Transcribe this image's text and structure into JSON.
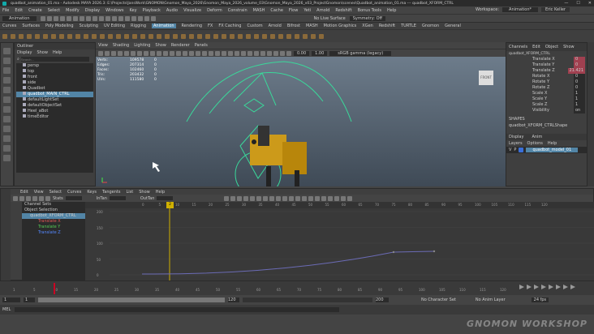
{
  "titlebar": {
    "title": "quadbot_animation_01.ma - Autodesk MAYA 2026.3: E:\\Projects\\JansWork\\GNOMON\\Gnomon_Maya_2026\\Gnomon_Maya_2026_volume_03\\Gnomon_Maya_2026_v03_ProjectGnomon\\scenes\\Quadbot_animation_01.ma --- quadbot_XFORM_CTRL"
  },
  "menubar": {
    "items": [
      "File",
      "Edit",
      "Create",
      "Select",
      "Modify",
      "Display",
      "Windows",
      "Key",
      "Playback",
      "Audio",
      "Visualize",
      "Deform",
      "Constrain",
      "MASH",
      "Cache",
      "Flow",
      "Yeti",
      "Arnold",
      "Redshift",
      "Bonus Tools",
      "Help"
    ],
    "workspace_label": "Workspace:",
    "workspace_value": "Animation*",
    "user": "Eric Keller"
  },
  "statusline": {
    "mode": "Animation",
    "no_live_surface": "No Live Surface",
    "symmetry": "Symmetry: Off"
  },
  "shelf_tabs": [
    "Curves",
    "Surfaces",
    "Poly Modeling",
    "Sculpting",
    "UV Editing",
    "Rigging",
    "Animation",
    "Rendering",
    "FX",
    "FX Caching",
    "Custom",
    "Arnold",
    "Bifrost",
    "MASH",
    "Motion Graphics",
    "XGen",
    "Redshift",
    "TURTLE",
    "Gnomon",
    "General"
  ],
  "outliner": {
    "title": "Outliner",
    "menus": [
      "Display",
      "Show",
      "Help"
    ],
    "search_placeholder": "Search...",
    "items": [
      "persp",
      "top",
      "front",
      "side",
      "Quadbot",
      "quadbot_MAIN_CTRL",
      "defaultLightSet",
      "defaultObjectSet",
      "Heel_aBot",
      "timeEditor"
    ]
  },
  "viewport": {
    "menus": [
      "View",
      "Shading",
      "Lighting",
      "Show",
      "Renderer",
      "Panels"
    ],
    "hud_labels": [
      "Verts:",
      "Edges:",
      "Faces:",
      "Tris:",
      "UVs:"
    ],
    "hud_values": [
      "109578",
      "207314",
      "102460",
      "203432",
      "111580"
    ],
    "hud_zero": [
      "0",
      "0",
      "0",
      "0",
      "0"
    ],
    "camera_label": "FRONT",
    "renderer": "sRGB gamma (legacy)",
    "field_a": "0.00",
    "field_b": "1.00"
  },
  "channelbox": {
    "menus": [
      "Channels",
      "Edit",
      "Object",
      "Show"
    ],
    "object": "quadbot_XFORM_CTRL",
    "channels": [
      {
        "name": "Translate X",
        "value": "0"
      },
      {
        "name": "Translate Y",
        "value": "0"
      },
      {
        "name": "Translate Z",
        "value": "21.421"
      },
      {
        "name": "Rotate X",
        "value": "0"
      },
      {
        "name": "Rotate Y",
        "value": "0"
      },
      {
        "name": "Rotate Z",
        "value": "0"
      },
      {
        "name": "Scale X",
        "value": "1"
      },
      {
        "name": "Scale Y",
        "value": "1"
      },
      {
        "name": "Scale Z",
        "value": "1"
      },
      {
        "name": "Visibility",
        "value": "on"
      }
    ],
    "shapes_label": "SHAPES",
    "shape_name": "quadbot_XFORM_CTRLShape",
    "layer_tabs": [
      "Display",
      "Anim"
    ],
    "layer_menus": [
      "Layers",
      "Options",
      "Help"
    ],
    "layer_name": "quadbot_model_01"
  },
  "grapheditor": {
    "menus": [
      "Edit",
      "View",
      "Select",
      "Curves",
      "Keys",
      "Tangents",
      "List",
      "Show",
      "Help"
    ],
    "stats_label": "Stats",
    "intan_label": "InTan",
    "outtan_label": "OutTan",
    "outline_items": [
      "Channel Sets",
      "Object Selection",
      "quadbot_XFORM_CTRL",
      "Translate X",
      "Translate Y",
      "Translate Z"
    ],
    "y_ticks": [
      "200",
      "150",
      "100",
      "50",
      "0"
    ],
    "x_ticks": [
      "0",
      "5",
      "10",
      "15",
      "20",
      "25",
      "30",
      "35",
      "40",
      "45",
      "50",
      "55",
      "60",
      "65",
      "70",
      "75",
      "80",
      "85",
      "90",
      "95",
      "100",
      "105",
      "110",
      "115",
      "120"
    ],
    "current_frame": "2",
    "graph_side_label": "Graph Editor",
    "curve_color": "#6b6bb5"
  },
  "timeslider": {
    "ticks": [
      "1",
      "5",
      "10",
      "15",
      "20",
      "25",
      "30",
      "35",
      "40",
      "45",
      "50",
      "55",
      "60",
      "65",
      "70",
      "75",
      "80",
      "85",
      "90",
      "95",
      "100",
      "105",
      "110",
      "115",
      "120"
    ],
    "current": "12"
  },
  "rangeslider": {
    "start": "1",
    "range_start": "1",
    "range_end": "120",
    "anim_end": "120",
    "max": "200",
    "no_char": "No Character Set",
    "no_layer": "No Anim Layer",
    "fps": "24 fps"
  },
  "cmdline": {
    "label": "MEL"
  },
  "watermark": "GNOMON WORKSHOP",
  "colors": {
    "accent": "#5285a6",
    "key": "#d0b000",
    "ctrl": "#3ad89a"
  }
}
